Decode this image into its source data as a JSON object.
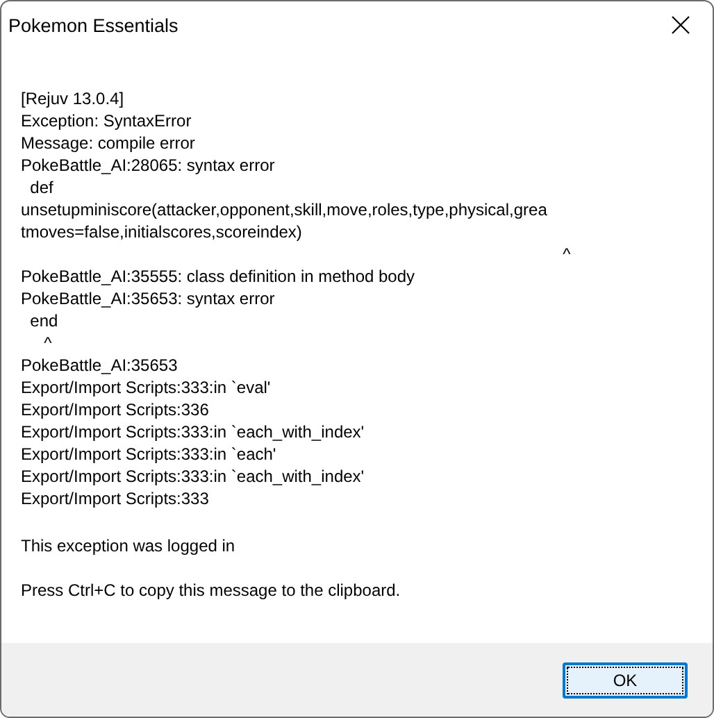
{
  "window": {
    "title": "Pokemon Essentials"
  },
  "message": {
    "lines": [
      "[Rejuv 13.0.4]",
      "Exception: SyntaxError",
      "Message: compile error",
      "PokeBattle_AI:28065: syntax error",
      "  def",
      "unsetupminiscore(attacker,opponent,skill,move,roles,type,physical,grea",
      "tmoves=false,initialscores,scoreindex)",
      "                                                                                                                     ^",
      "PokeBattle_AI:35555: class definition in method body",
      "PokeBattle_AI:35653: syntax error",
      "  end",
      "     ^",
      "PokeBattle_AI:35653",
      "Export/Import Scripts:333:in `eval'",
      "Export/Import Scripts:336",
      "Export/Import Scripts:333:in `each_with_index'",
      "Export/Import Scripts:333:in `each'",
      "Export/Import Scripts:333:in `each_with_index'",
      "Export/Import Scripts:333"
    ],
    "log_note": "This exception was logged in",
    "copy_hint": "Press Ctrl+C to copy this message to the clipboard."
  },
  "buttons": [
    {
      "label": "OK",
      "default": true
    }
  ]
}
